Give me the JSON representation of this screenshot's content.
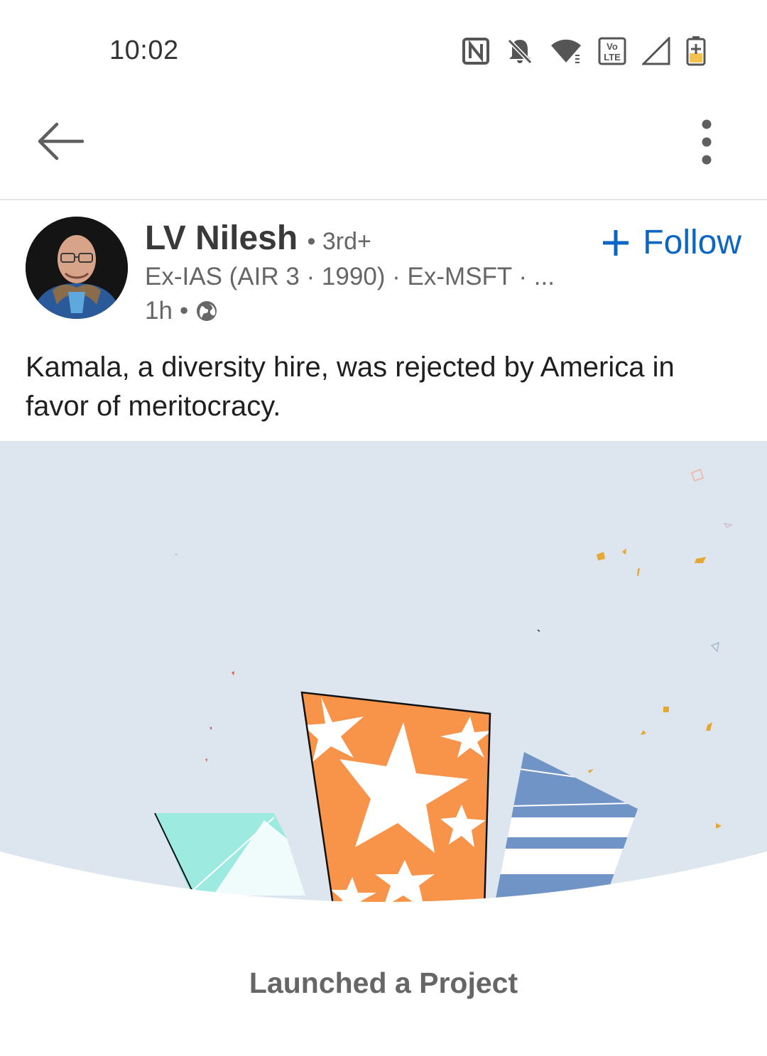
{
  "status_bar": {
    "time": "10:02",
    "icons": [
      "nfc-icon",
      "bell-off-icon",
      "wifi-icon",
      "volte-icon",
      "signal-icon",
      "battery-charging-icon"
    ],
    "volte_label": "Vo LTE"
  },
  "app_bar": {
    "back_icon": "arrow-left-icon",
    "more_icon": "more-vertical-icon"
  },
  "post": {
    "author": {
      "name": "LV Nilesh",
      "degree": "• 3rd+",
      "headline": "Ex-IAS (AIR 3 · 1990) · Ex-MSFT · ...",
      "time": "1h",
      "separator": "•",
      "visibility_icon": "globe-icon"
    },
    "follow": {
      "icon": "plus-icon",
      "label": "Follow"
    },
    "text": "Kamala, a diversity hire, was rejected by America in favor of meritocracy.",
    "media": {
      "caption": "Launched a Project",
      "colors": {
        "background": "#dde5ef",
        "orange": "#f8934a",
        "blue": "#7194c6",
        "teal": "#9deae0",
        "confetti": "#e5a833"
      }
    }
  },
  "colors": {
    "accent": "#0a66c2",
    "text_secondary": "#666666",
    "text_primary": "#1f1f1f"
  }
}
